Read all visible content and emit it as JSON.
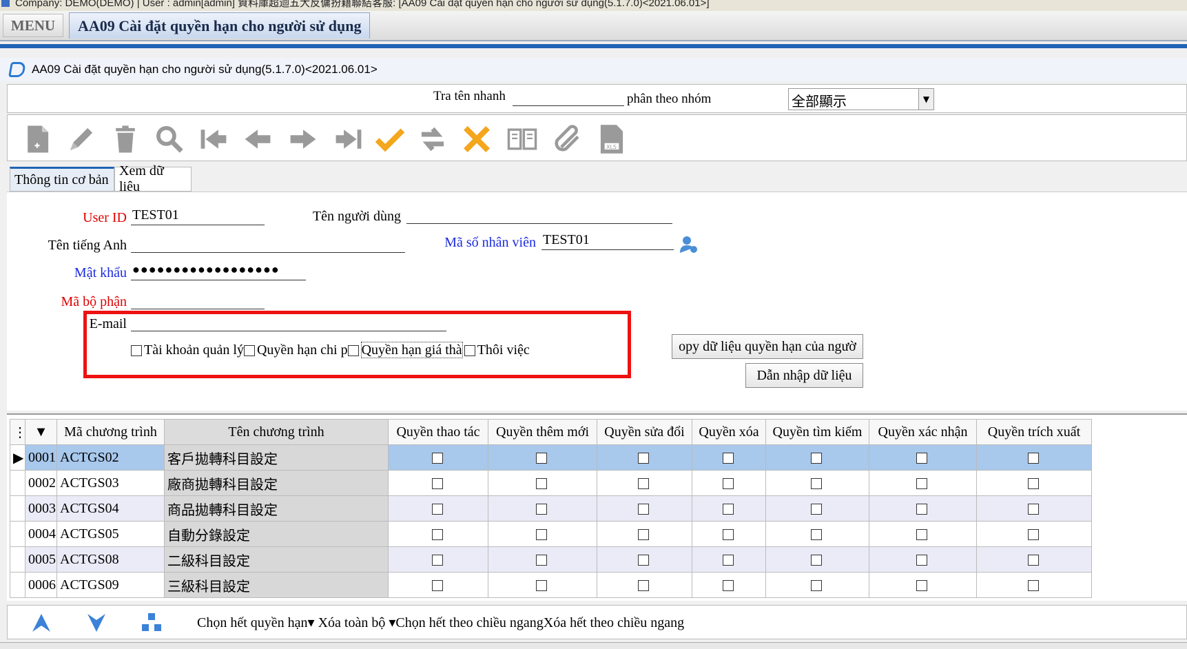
{
  "window": {
    "title": "Company: DEMO(DEMO) | User : admin[admin] 資料庫超迴五大反傭扮籍聯結客服: [AA09 Cài đặt quyền hạn cho người sử dụng(5.1.7.0)<2021.06.01>]"
  },
  "menubar": {
    "menu_label": "MENU",
    "active_tab": "AA09 Cài đặt quyền hạn cho người sử dụng"
  },
  "form": {
    "title": "AA09 Cài đặt quyền hạn cho người sử dụng(5.1.7.0)<2021.06.01>"
  },
  "quick": {
    "search_label": "Tra tên nhanh",
    "group_label": "phân theo nhóm",
    "group_value": "全部顯示"
  },
  "toolbar": {
    "icons": [
      "new-icon",
      "edit-icon",
      "delete-icon",
      "search-icon",
      "first-icon",
      "prev-icon",
      "next-icon",
      "last-icon",
      "confirm-icon",
      "refresh-icon",
      "cancel-icon",
      "book-icon",
      "attach-icon",
      "excel-icon"
    ]
  },
  "tabs": [
    {
      "label": "Thông tin cơ bản"
    },
    {
      "label": "Xem dữ liệu"
    }
  ],
  "fields": {
    "user_id_label": "User ID",
    "user_id": "TEST01",
    "user_name_label": "Tên người dùng",
    "user_name": "",
    "english_name_label": "Tên tiếng Anh",
    "english_name": "",
    "employee_code_label": "Mã số nhân viên",
    "employee_code": "TEST01",
    "password_label": "Mật khẩu",
    "password": "●●●●●●●●●●●●●●●●●●",
    "dept_label": "Mã bộ phận",
    "dept": "",
    "email_label": "E-mail",
    "email": ""
  },
  "checkboxes": {
    "admin": "Tài khoản quản lý",
    "partial": "Quyền hạn chi p",
    "price": "Quyền hạn giá thà",
    "resigned": "Thôi việc"
  },
  "buttons": {
    "copy": "opy dữ liệu quyền hạn của ngườ",
    "import": "Dẫn nhập dữ liệu"
  },
  "grid": {
    "columns": [
      "Mã chương trình",
      "Tên chương trình",
      "Quyền thao tác",
      "Quyền thêm mới",
      "Quyền sửa đổi",
      "Quyền xóa",
      "Quyền tìm kiếm",
      "Quyền xác nhận",
      "Quyền trích xuất"
    ],
    "rows": [
      {
        "no": "0001",
        "code": "ACTGS02",
        "name": "客戶拋轉科目設定"
      },
      {
        "no": "0002",
        "code": "ACTGS03",
        "name": "廠商拋轉科目設定"
      },
      {
        "no": "0003",
        "code": "ACTGS04",
        "name": "商品拋轉科目設定"
      },
      {
        "no": "0004",
        "code": "ACTGS05",
        "name": "自動分錄設定"
      },
      {
        "no": "0005",
        "code": "ACTGS08",
        "name": "二級科目設定"
      },
      {
        "no": "0006",
        "code": "ACTGS09",
        "name": "三級科目設定"
      }
    ]
  },
  "bottom": {
    "actions": "Chọn hết quyền hạn▾ Xóa toàn bộ ▾Chọn hết theo chiều ngangXóa hết theo chiều ngang"
  }
}
